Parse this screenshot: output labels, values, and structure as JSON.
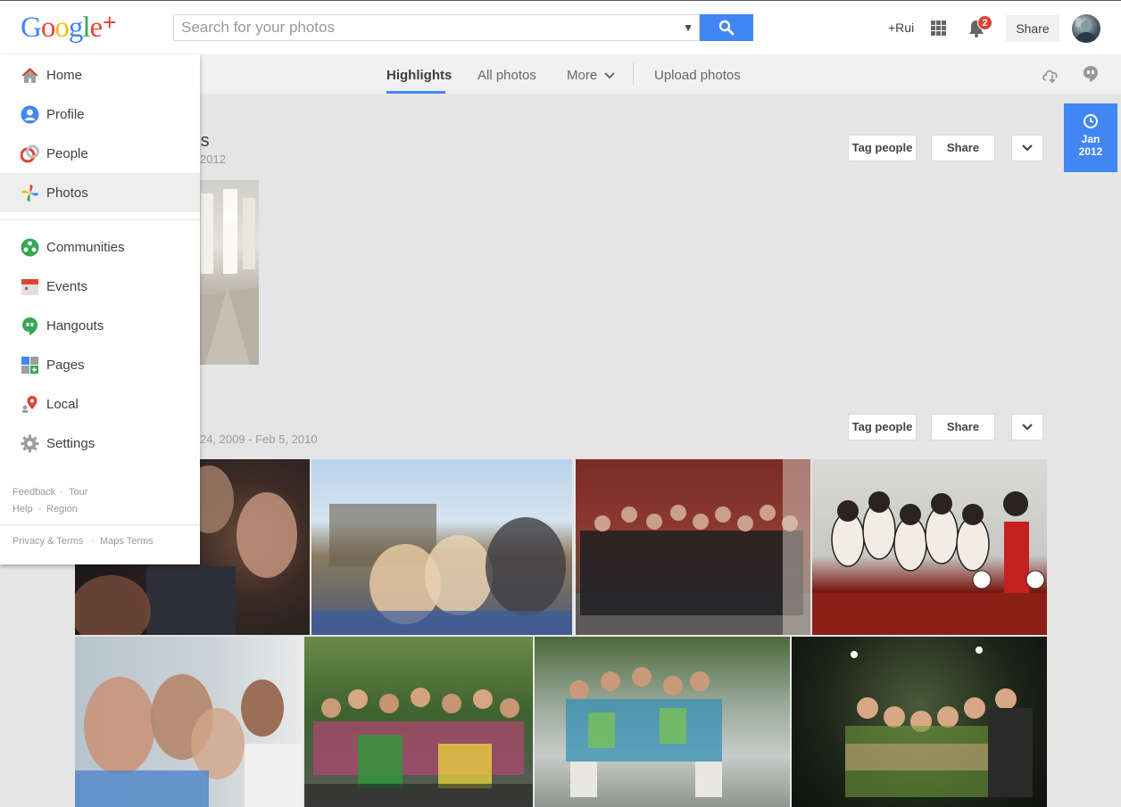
{
  "header": {
    "logo_letters": [
      "G",
      "o",
      "o",
      "g",
      "l",
      "e"
    ],
    "logo_plus": "+",
    "search_placeholder": "Search for your photos",
    "user_link": "+Rui",
    "notification_count": "2",
    "share_label": "Share"
  },
  "subnav": {
    "tabs": [
      {
        "label": "Highlights",
        "active": true
      },
      {
        "label": "All photos",
        "active": false
      },
      {
        "label": "More",
        "active": false
      },
      {
        "label": "Upload photos",
        "active": false
      }
    ]
  },
  "sidebar": {
    "items": [
      {
        "label": "Home",
        "icon": "home-icon"
      },
      {
        "label": "Profile",
        "icon": "profile-icon"
      },
      {
        "label": "People",
        "icon": "people-icon"
      },
      {
        "label": "Photos",
        "icon": "photos-icon",
        "active": true
      },
      {
        "label": "Communities",
        "icon": "communities-icon"
      },
      {
        "label": "Events",
        "icon": "events-icon"
      },
      {
        "label": "Hangouts",
        "icon": "hangouts-icon"
      },
      {
        "label": "Pages",
        "icon": "pages-icon"
      },
      {
        "label": "Local",
        "icon": "local-icon"
      },
      {
        "label": "Settings",
        "icon": "settings-icon"
      }
    ],
    "footer": {
      "feedback": "Feedback",
      "tour": "Tour",
      "help": "Help",
      "region": "Region",
      "privacy_terms": "Privacy & Terms",
      "maps_terms": "Maps Terms",
      "dot": "·"
    }
  },
  "date_tab": {
    "month": "Jan",
    "year": "2012"
  },
  "albums": [
    {
      "title_visible": "tos",
      "date_visible": "2012",
      "tag_label": "Tag people",
      "share_label": "Share"
    },
    {
      "date_visible": "24, 2009 - Feb 5, 2010",
      "tag_label": "Tag people",
      "share_label": "Share"
    }
  ],
  "colors": {
    "accent_blue": "#4285f4",
    "badge_red": "#db4437",
    "background": "#e5e5e5"
  }
}
